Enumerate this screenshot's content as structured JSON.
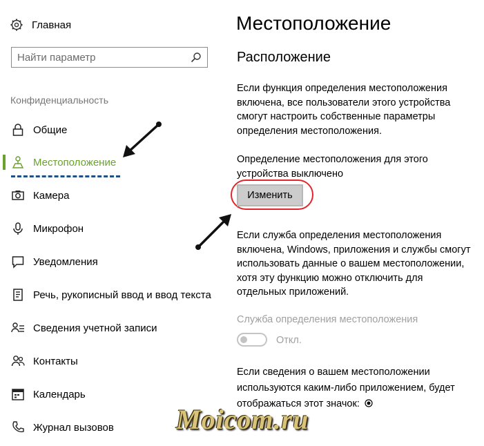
{
  "sidebar": {
    "home_label": "Главная",
    "search_placeholder": "Найти параметр",
    "section_title": "Конфиденциальность",
    "items": [
      {
        "label": "Общие",
        "icon": "lock-icon"
      },
      {
        "label": "Местоположение",
        "icon": "location-icon",
        "active": true
      },
      {
        "label": "Камера",
        "icon": "camera-icon"
      },
      {
        "label": "Микрофон",
        "icon": "microphone-icon"
      },
      {
        "label": "Уведомления",
        "icon": "notifications-icon"
      },
      {
        "label": "Речь, рукописный ввод и ввод текста",
        "icon": "speech-icon"
      },
      {
        "label": "Сведения учетной записи",
        "icon": "account-info-icon"
      },
      {
        "label": "Контакты",
        "icon": "contacts-icon"
      },
      {
        "label": "Календарь",
        "icon": "calendar-icon"
      },
      {
        "label": "Журнал вызовов",
        "icon": "call-history-icon"
      }
    ]
  },
  "main": {
    "title": "Местоположение",
    "subtitle": "Расположение",
    "para1": "Если функция определения местоположения включена, все пользователи этого устройства смогут настроить собственные параметры определения местоположения.",
    "status_text": "Определение местоположения для этого устройства выключено",
    "change_button": "Изменить",
    "para2": "Если служба определения местоположения включена, Windows, приложения и службы смогут использовать данные о вашем местоположении, хотя эту функцию можно отключить для отдельных приложений.",
    "service_label": "Служба определения местоположения",
    "toggle_state": "Откл.",
    "para3": "Если сведения о вашем местоположении используются каким-либо приложением, будет отображаться этот значок:"
  },
  "watermark": "Moicom.ru",
  "colors": {
    "accent": "#6aa12f",
    "highlight_circle": "#e0262b",
    "underline": "#1e4f86"
  }
}
